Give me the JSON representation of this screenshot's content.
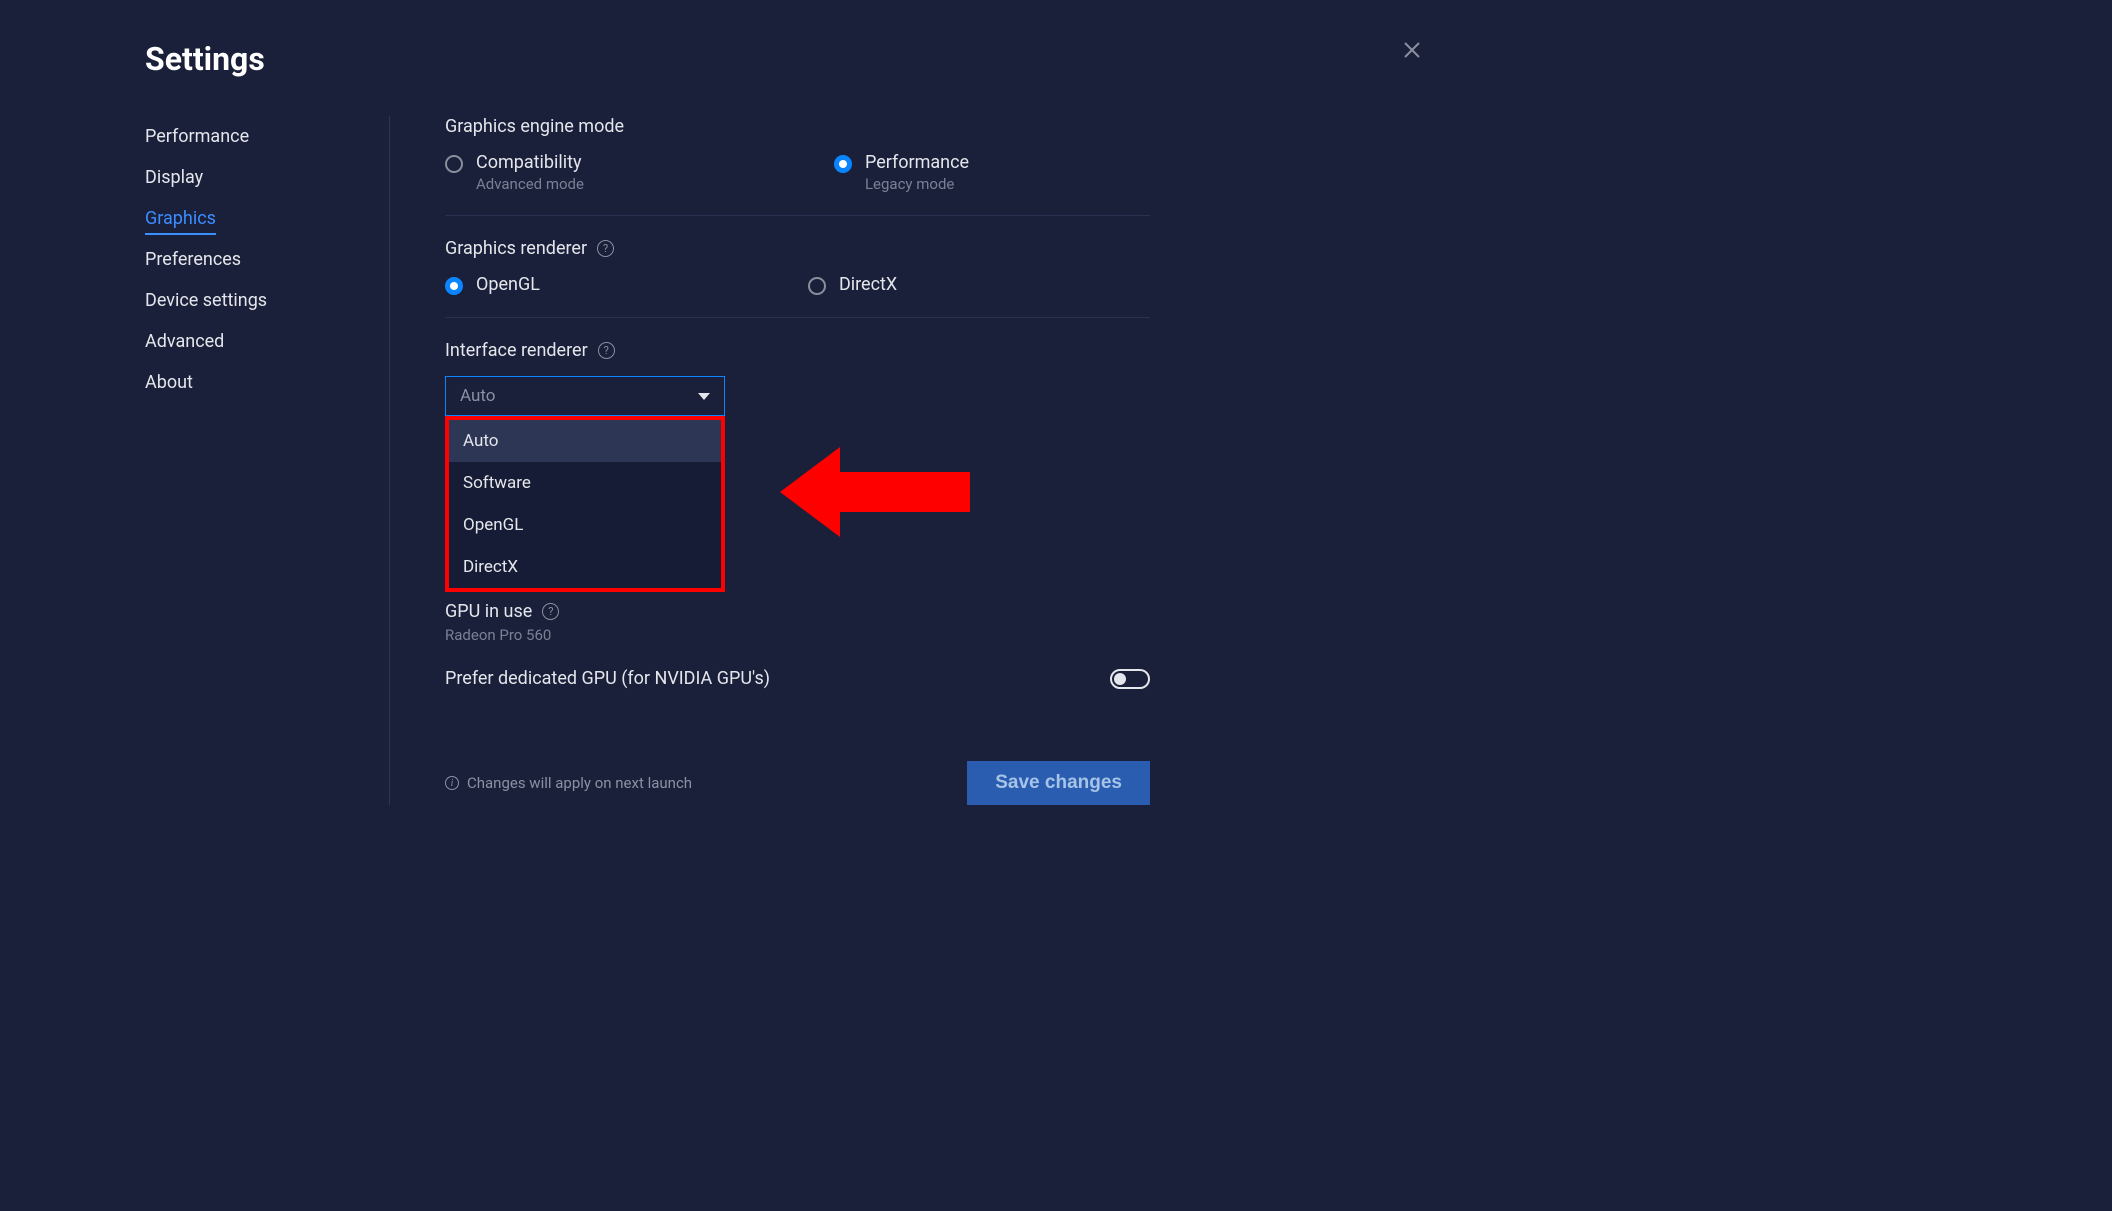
{
  "title": "Settings",
  "sidebar": {
    "items": [
      {
        "label": "Performance"
      },
      {
        "label": "Display"
      },
      {
        "label": "Graphics"
      },
      {
        "label": "Preferences"
      },
      {
        "label": "Device settings"
      },
      {
        "label": "Advanced"
      },
      {
        "label": "About"
      }
    ],
    "active_index": 2
  },
  "graphics_engine": {
    "title": "Graphics engine mode",
    "options": [
      {
        "label": "Compatibility",
        "sub": "Advanced mode",
        "checked": false
      },
      {
        "label": "Performance",
        "sub": "Legacy mode",
        "checked": true
      }
    ]
  },
  "graphics_renderer": {
    "title": "Graphics renderer",
    "options": [
      {
        "label": "OpenGL",
        "checked": true
      },
      {
        "label": "DirectX",
        "checked": false
      }
    ]
  },
  "interface_renderer": {
    "title": "Interface renderer",
    "selected": "Auto",
    "options": [
      "Auto",
      "Software",
      "OpenGL",
      "DirectX"
    ],
    "highlight_index": 0
  },
  "gpu": {
    "title": "GPU in use",
    "value": "Radeon Pro 560",
    "toggle_label": "Prefer dedicated GPU (for NVIDIA GPU's)",
    "toggle_on": false
  },
  "footer": {
    "info": "Changes will apply on next launch",
    "save": "Save changes"
  },
  "annotation": {
    "arrow_color": "#ff0000"
  }
}
